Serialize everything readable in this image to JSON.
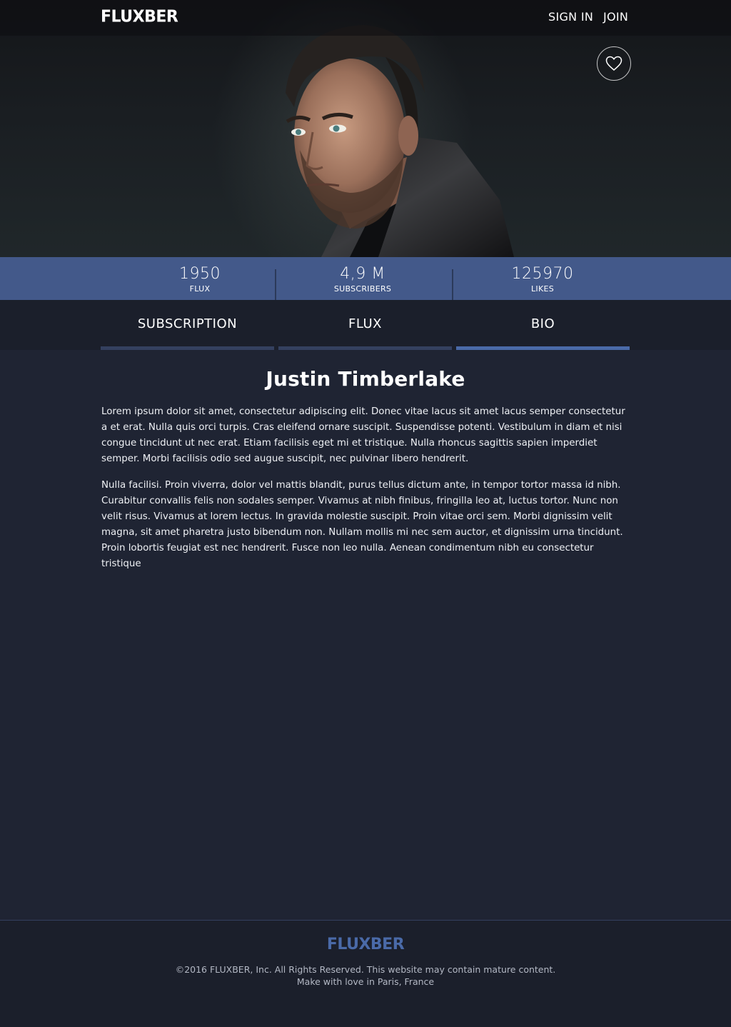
{
  "header": {
    "logo": "FLUXBER",
    "sign_in": "SIGN IN",
    "join": "JOIN"
  },
  "hero": {
    "favorite_icon": "heart-icon"
  },
  "stats": [
    {
      "value": "1950",
      "label": "FLUX"
    },
    {
      "value": "4,9 M",
      "label": "SUBSCRIBERS"
    },
    {
      "value": "125970",
      "label": "LIKES"
    }
  ],
  "tabs": [
    {
      "label": "SUBSCRIPTION",
      "active": false
    },
    {
      "label": "FLUX",
      "active": false
    },
    {
      "label": "BIO",
      "active": true
    }
  ],
  "bio": {
    "name": "Justin Timberlake",
    "paragraphs": [
      "Lorem ipsum dolor sit amet, consectetur adipiscing elit. Donec vitae lacus sit amet lacus semper consectetur a et erat. Nulla quis orci turpis. Cras eleifend ornare suscipit. Suspendisse potenti. Vestibulum in diam et nisi congue tincidunt ut nec erat. Etiam facilisis eget mi et tristique. Nulla rhoncus sagittis sapien imperdiet semper. Morbi facilisis odio sed augue suscipit, nec pulvinar libero hendrerit.",
      "Nulla facilisi. Proin viverra, dolor vel mattis blandit, purus tellus dictum ante, in tempor tortor massa id nibh. Curabitur convallis felis non sodales semper. Vivamus at nibh finibus, fringilla leo at, luctus tortor. Nunc non velit risus. Vivamus at lorem lectus. In gravida molestie suscipit. Proin vitae orci sem. Morbi dignissim velit magna, sit amet pharetra justo bibendum non. Nullam mollis mi nec sem auctor, et dignissim urna tincidunt. Proin lobortis feugiat est nec hendrerit. Fusce non leo nulla. Aenean condimentum nibh eu consectetur tristique"
    ]
  },
  "footer": {
    "logo": "FLUXBER",
    "copyright": "©2016 FLUXBER, Inc. All Rights Reserved. This website may contain mature content.",
    "tagline": "Make with love in Paris, France"
  },
  "colors": {
    "background": "#1f2433",
    "stats_bar": "#43598a",
    "accent": "#4a6aa8",
    "tab_bar": "#1b1f2b"
  }
}
